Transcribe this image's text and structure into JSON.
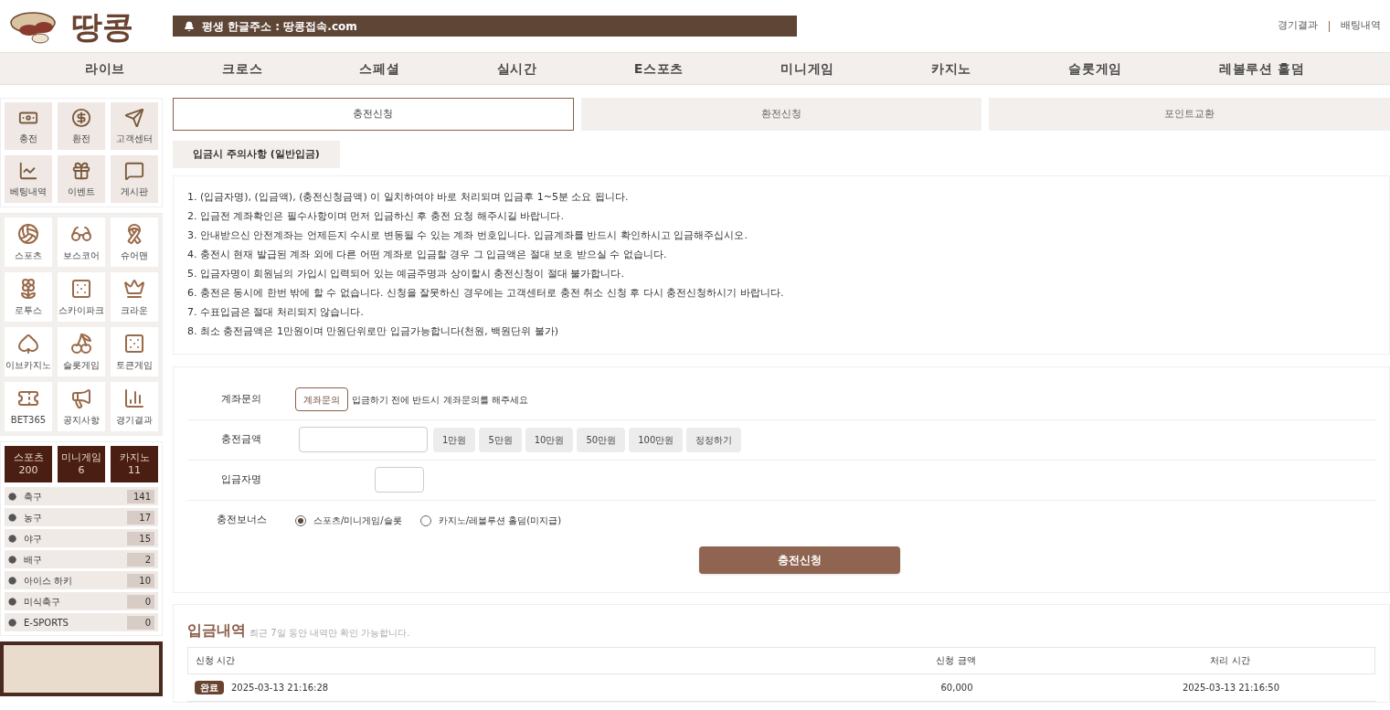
{
  "header": {
    "logo_text": "땅콩",
    "notice": "평생 한글주소 : 땅콩접속.com",
    "links": [
      "경기결과",
      "배팅내역"
    ]
  },
  "nav": [
    "라이브",
    "크로스",
    "스페셜",
    "실시간",
    "E스포츠",
    "미니게임",
    "카지노",
    "슬롯게임",
    "레볼루션 홀덤"
  ],
  "sidebar": {
    "quick_menu": [
      "충전",
      "환전",
      "고객센터",
      "베팅내역",
      "이벤트",
      "게시판"
    ],
    "games": [
      "스포츠",
      "보스코어",
      "슈어맨",
      "로투스",
      "스카이파크",
      "크라운",
      "이브카지노",
      "슬롯게임",
      "토큰게임",
      "BET365",
      "공지사항",
      "경기결과"
    ],
    "count_tabs": [
      {
        "label": "스포츠",
        "count": "200"
      },
      {
        "label": "미니게임",
        "count": "6"
      },
      {
        "label": "카지노",
        "count": "11"
      }
    ],
    "sports": [
      {
        "name": "축구",
        "count": "141"
      },
      {
        "name": "농구",
        "count": "17"
      },
      {
        "name": "야구",
        "count": "15"
      },
      {
        "name": "배구",
        "count": "2"
      },
      {
        "name": "아이스 하키",
        "count": "10"
      },
      {
        "name": "미식축구",
        "count": "0"
      },
      {
        "name": "E-SPORTS",
        "count": "0"
      }
    ]
  },
  "tabs": [
    {
      "label": "충전신청",
      "selected": true
    },
    {
      "label": "환전신청",
      "selected": false
    },
    {
      "label": "포인트교환",
      "selected": false
    }
  ],
  "notice_tab": "입금시 주의사항 (일반입금)",
  "notices": [
    "1. (입금자명), (입금액), (충전신청금액) 이 일치하여야 바로 처리되며 입금후 1~5분 소요 됩니다.",
    "2. 입금전 계좌확인은 필수사항이며 먼저 입금하신 후 충전 요청 해주시길 바랍니다.",
    "3. 안내받으신 안전계좌는 언제든지 수시로 변동될 수 있는 계좌 번호입니다. 입금계좌를 반드시 확인하시고 입금해주십시오.",
    "4. 충전시 현재 발급된 계좌 외에 다른 어떤 계좌로 입금할 경우 그 입금액은 절대 보호 받으실 수 없습니다.",
    "5. 입금자명이 회원님의 가입시 입력되어 있는 예금주명과 상이할시 충전신청이 절대 불가합니다.",
    "6. 충전은 동시에 한번 밖에 할 수 없습니다. 신청을 잘못하신 경우에는 고객센터로 충전 취소 신청 후 다시 충전신청하시기 바랍니다.",
    "7. 수표입금은 절대 처리되지 않습니다.",
    "8. 최소 충전금액은 1만원이며 만원단위로만 입금가능합니다(천원, 백원단위 불가)"
  ],
  "form": {
    "account": {
      "label": "계좌문의",
      "button": "계좌문의",
      "hint": "입금하기 전에 반드시 계좌문의를 해주세요"
    },
    "amount": {
      "label": "충전금액",
      "buttons": [
        "1만원",
        "5만원",
        "10만원",
        "50만원",
        "100만원",
        "정정하기"
      ]
    },
    "depositor": {
      "label": "입금자명"
    },
    "bonus": {
      "label": "충전보너스",
      "options": [
        {
          "label": "스포츠/미니게임/슬롯",
          "selected": true
        },
        {
          "label": "카지노/레볼루션 홀덤(미지급)",
          "selected": false
        }
      ]
    },
    "submit": "충전신청"
  },
  "history": {
    "title": "입금내역",
    "subtitle": "최근 7일 동안 내역만 확인 가능합니다.",
    "columns": [
      "신청 시간",
      "신청 금액",
      "처리 시간"
    ],
    "rows": [
      {
        "status": "완료",
        "time": "2025-03-13 21:16:28",
        "amount": "60,000",
        "processed": "2025-03-13 21:16:50"
      }
    ]
  }
}
